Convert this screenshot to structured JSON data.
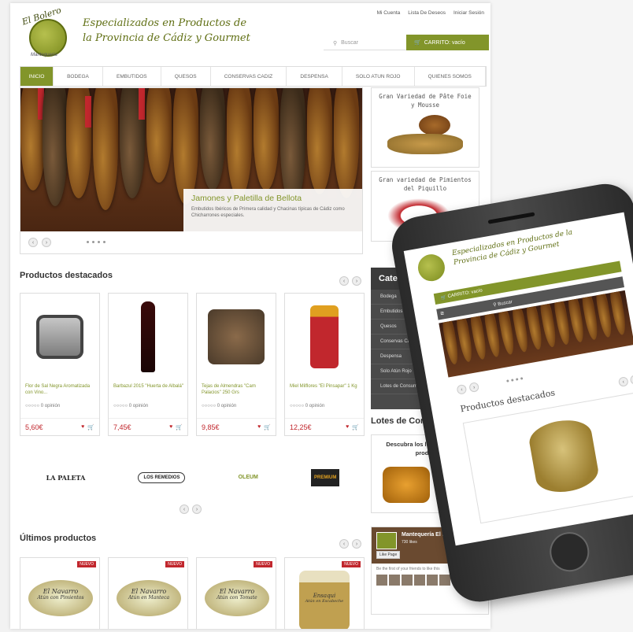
{
  "header": {
    "logo_text": "El Bolero",
    "logo_sub": "Mantequería",
    "tagline_line1": "Especializados en Productos de",
    "tagline_line2": "la Provincia de Cádiz y Gourmet",
    "top_links": [
      "Mi Cuenta",
      "Lista De Deseos",
      "Iniciar Sesión"
    ],
    "search_placeholder": "Buscar",
    "cart_label": "CARRITO: vacío"
  },
  "nav": {
    "items": [
      "INICIO",
      "BODEGA",
      "EMBUTIDOS",
      "QUESOS",
      "CONSERVAS CADIZ",
      "DESPENSA",
      "SOLO ATUN ROJO",
      "QUIENES SOMOS"
    ]
  },
  "slider": {
    "title": "Jamones y Paletilla de Bellota",
    "description": "Embutidos Ibéricos de Primera calidad y Chacinas típicas de Cádiz como Chicharrones especiales."
  },
  "promos": [
    {
      "text": "Gran Variedad de Pâte Foie y Mousse"
    },
    {
      "text": "Gran variedad de Pimientos del Piquillo"
    }
  ],
  "featured": {
    "title": "Productos destacados",
    "products": [
      {
        "name": "Flor de Sal Negra Aromatizada con Vino...",
        "rating": "0 opinión",
        "price": "5,60€"
      },
      {
        "name": "Barbazul 2015 \"Huerta de Albalá\"",
        "rating": "0 opinión",
        "price": "7,45€"
      },
      {
        "name": "Tejas de Almendras \"Cam Palacios\" 250 Grs",
        "rating": "0 opinión",
        "price": "9,85€"
      },
      {
        "name": "Miel Milflores \"El Pinsapar\" 1 Kg",
        "rating": "0 opinión",
        "price": "12,25€"
      }
    ]
  },
  "brands": [
    "LA PALETA",
    "LOS REMEDIOS",
    "OLEUM",
    "PREMIUM"
  ],
  "latest": {
    "title": "Últimos productos",
    "badge": "NUEVO",
    "products": [
      {
        "label": "El Navarro",
        "subtitle": "Atún con Pimientos"
      },
      {
        "label": "El Navarro",
        "subtitle": "Atún en Manteca"
      },
      {
        "label": "El Navarro",
        "subtitle": "Atún con Tomate"
      },
      {
        "label": "Ensaqui",
        "subtitle": "Atún en Escabeche"
      }
    ]
  },
  "categories": {
    "title": "Categorías",
    "items": [
      "Bodega",
      "Embutidos",
      "Quesos",
      "Conservas Cádiz",
      "Despensa",
      "Solo Atún Rojo",
      "Lotes de Consumo"
    ]
  },
  "lotes": {
    "title": "Lotes de Consumo",
    "promo": "Descubra los lotes de nuestros productos"
  },
  "facebook": {
    "page_name": "Mantequería El Bolero",
    "likes": "730 likes",
    "like_button": "Like Page",
    "friends_text": "Be the first of your friends to like this"
  },
  "mobile": {
    "tagline": "Especializados en Productos de la Provincia de Cádiz y Gourmet",
    "cart_label": "CARRITO: vacío",
    "search_placeholder": "Buscar",
    "featured_title": "Productos destacados"
  },
  "colors": {
    "accent": "#82952a",
    "price": "#c1272d"
  }
}
